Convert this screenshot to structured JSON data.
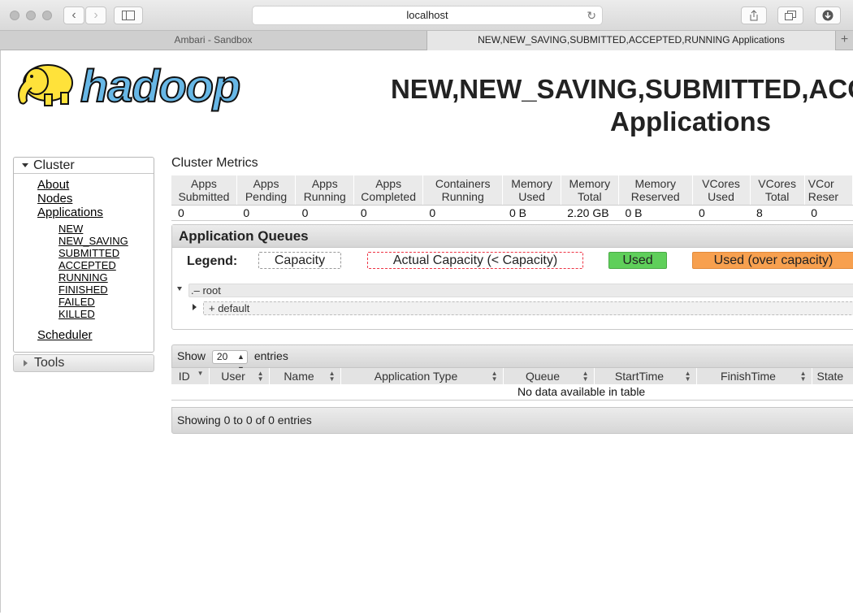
{
  "browser": {
    "address": "localhost",
    "tabs": [
      {
        "label": "Ambari - Sandbox"
      },
      {
        "label": "NEW,NEW_SAVING,SUBMITTED,ACCEPTED,RUNNING Applications"
      }
    ]
  },
  "header": {
    "logo_text": "hadoop",
    "title_line1": "NEW,NEW_SAVING,SUBMITTED,ACCE",
    "title_line2": "Applications"
  },
  "sidebar": {
    "cluster_label": "Cluster",
    "links": {
      "about": "About",
      "nodes": "Nodes",
      "applications": "Applications",
      "scheduler": "Scheduler"
    },
    "states": [
      "NEW",
      "NEW_SAVING",
      "SUBMITTED",
      "ACCEPTED",
      "RUNNING",
      "FINISHED",
      "FAILED",
      "KILLED"
    ],
    "tools_label": "Tools"
  },
  "metrics": {
    "title": "Cluster Metrics",
    "headers": [
      [
        "Apps",
        "Submitted"
      ],
      [
        "Apps",
        "Pending"
      ],
      [
        "Apps",
        "Running"
      ],
      [
        "Apps",
        "Completed"
      ],
      [
        "Containers",
        "Running"
      ],
      [
        "Memory",
        "Used"
      ],
      [
        "Memory",
        "Total"
      ],
      [
        "Memory",
        "Reserved"
      ],
      [
        "VCores",
        "Used"
      ],
      [
        "VCores",
        "Total"
      ],
      [
        "VCor",
        "Reser"
      ]
    ],
    "values": [
      "0",
      "0",
      "0",
      "0",
      "0",
      "0 B",
      "2.20 GB",
      "0 B",
      "0",
      "8",
      "0"
    ]
  },
  "queues": {
    "title": "Application Queues",
    "legend_label": "Legend:",
    "legend": {
      "capacity": "Capacity",
      "actual": "Actual Capacity (< Capacity)",
      "used": "Used",
      "over": "Used (over capacity)"
    },
    "root_label": ".– root",
    "default_label": "+ default"
  },
  "apps": {
    "show_label": "Show",
    "show_value": "20",
    "entries_label": "entries",
    "columns": [
      "ID",
      "User",
      "Name",
      "Application Type",
      "Queue",
      "StartTime",
      "FinishTime",
      "State"
    ],
    "empty_text": "No data available in table",
    "footer": "Showing 0 to 0 of 0 entries"
  },
  "colors": {
    "used": "#5fcf5a",
    "over": "#f7a04f",
    "actual_border": "#e34"
  }
}
